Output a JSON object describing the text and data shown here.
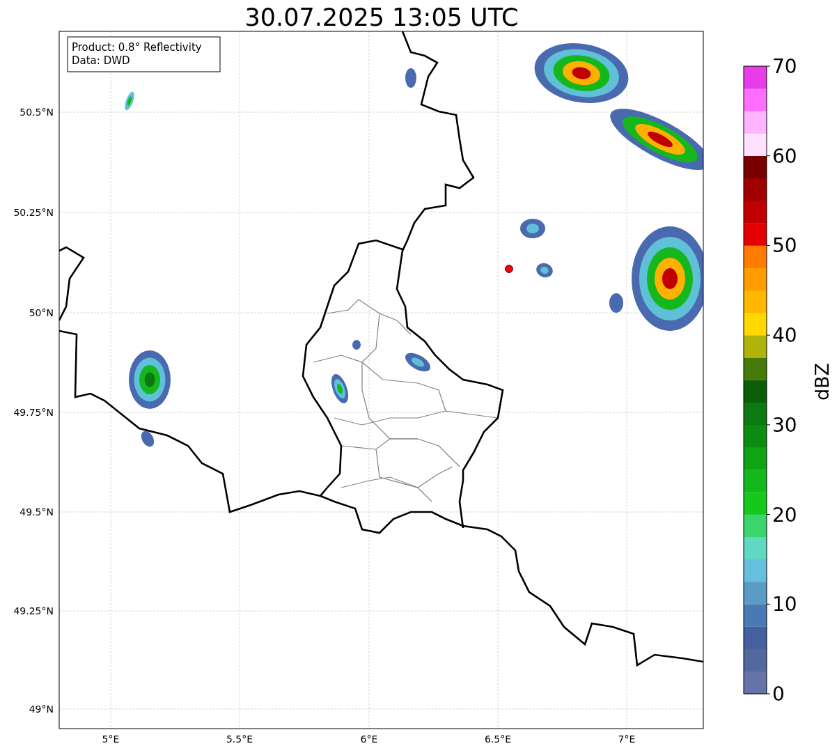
{
  "title": "30.07.2025 13:05 UTC",
  "info_box": [
    "Product: 0.8° Reflectivity",
    "Data: DWD"
  ],
  "y_ticks": [
    "50.5°N",
    "50.25°N",
    "50°N",
    "49.75°N",
    "49.5°N",
    "49.25°N",
    "49°N"
  ],
  "x_ticks": [
    "5°E",
    "5.5°E",
    "6°E",
    "6.5°E",
    "7°E"
  ],
  "colorbar": {
    "label": "dBZ",
    "ticks": [
      "70",
      "60",
      "50",
      "40",
      "30",
      "20",
      "10",
      "0"
    ],
    "segments": [
      {
        "color": "#6474a8"
      },
      {
        "color": "#5468a0"
      },
      {
        "color": "#4460a0"
      },
      {
        "color": "#4a7ab4"
      },
      {
        "color": "#5a9cc6"
      },
      {
        "color": "#64c0dc"
      },
      {
        "color": "#60d8c4"
      },
      {
        "color": "#3cd46c"
      },
      {
        "color": "#14c81c"
      },
      {
        "color": "#14b81c"
      },
      {
        "color": "#10a414"
      },
      {
        "color": "#0e8c12"
      },
      {
        "color": "#0c7a10"
      },
      {
        "color": "#0a5e0a"
      },
      {
        "color": "#467a0a"
      },
      {
        "color": "#b0b40a"
      },
      {
        "color": "#ffd800"
      },
      {
        "color": "#ffb800"
      },
      {
        "color": "#ff9c00"
      },
      {
        "color": "#ff7c00"
      },
      {
        "color": "#e40000"
      },
      {
        "color": "#c00000"
      },
      {
        "color": "#a00000"
      },
      {
        "color": "#780000"
      },
      {
        "color": "#ffe0ff"
      },
      {
        "color": "#ffb4ff"
      },
      {
        "color": "#ff6eff"
      },
      {
        "color": "#e83ce8"
      }
    ]
  }
}
